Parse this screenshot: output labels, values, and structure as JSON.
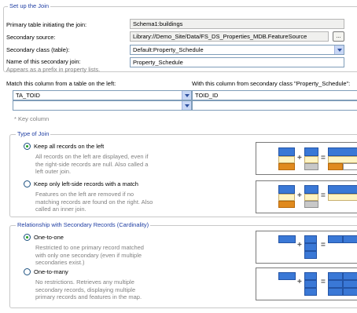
{
  "setup": {
    "title": "Set up the Join",
    "primary_label": "Primary table initiating the join:",
    "primary_value": "Schema1:buildings",
    "secondary_source_label": "Secondary source:",
    "secondary_source_value": "Library://Demo_Site/Data/FS_DS_Properties_MDB.FeatureSource",
    "browse_label": "...",
    "secondary_class_label": "Secondary class (table):",
    "secondary_class_value": "Default:Property_Schedule",
    "join_name_label": "Name of this secondary join:",
    "join_name_value": "Property_Schedule",
    "join_name_hint": "Appears as a prefix in property lists."
  },
  "match": {
    "left_label": "Match this column from a table on the left:",
    "right_label": "With this column from secondary class \"Property_Schedule\":",
    "rows": [
      {
        "left": "TA_TOID",
        "right": "TOID_ID"
      },
      {
        "left": "",
        "right": ""
      }
    ],
    "key_note": "* Key column"
  },
  "join_type": {
    "title": "Type of Join",
    "options": [
      {
        "label": "Keep all records on the left",
        "selected": true,
        "desc": [
          "All records on the left are displayed, even if",
          "the right-side records are null.  Also called a",
          "left outer join."
        ]
      },
      {
        "label": "Keep only left-side records with a match",
        "selected": false,
        "desc": [
          "Features on the left are removed if no",
          "matching records are found on the right.  Also",
          "called an inner join."
        ]
      }
    ]
  },
  "cardinality": {
    "title": "Relationship with Secondary Records (Cardinality)",
    "options": [
      {
        "label": "One-to-one",
        "selected": true,
        "desc": [
          "Restricted to one primary record matched",
          "with only one secondary (even if multiple",
          "secondaries exist.)"
        ]
      },
      {
        "label": "One-to-many",
        "selected": false,
        "desc": [
          "No restrictions. Retrieves any multiple",
          "secondary records, displaying multiple",
          "primary records and features in the map."
        ]
      }
    ]
  },
  "diagram_symbols": {
    "plus": "+",
    "equals": "="
  },
  "colors": {
    "accent_blue": "#3a78d6",
    "orange": "#e08a1e",
    "grey": "#c8c8c8",
    "legend_blue": "#1f3ea3"
  }
}
